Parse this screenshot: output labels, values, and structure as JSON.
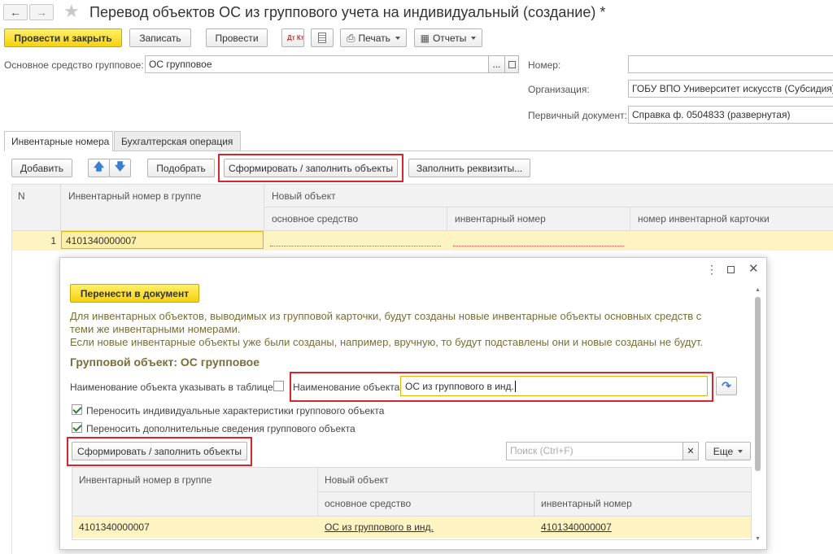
{
  "window": {
    "title": "Перевод объектов ОС из группового учета на индивидуальный (создание) *"
  },
  "toolbar": {
    "post_close": "Провести и закрыть",
    "save": "Записать",
    "post": "Провести",
    "dtkt": "Дт Кт",
    "print": "Печать",
    "reports": "Отчеты"
  },
  "header": {
    "os_group_label": "Основное средство групповое:",
    "os_group_value": "ОС групповое",
    "number_label": "Номер:",
    "number_value": "",
    "org_label": "Организация:",
    "org_value": "ГОБУ ВПО Университет искусств (Субсидия)",
    "primary_doc_label": "Первичный документ:",
    "primary_doc_value": "Справка ф. 0504833 (развернутая)"
  },
  "tabs": [
    {
      "label": "Инвентарные номера",
      "active": true
    },
    {
      "label": "Бухгалтерская операция",
      "active": false
    }
  ],
  "tab_toolbar": {
    "add": "Добавить",
    "pick": "Подобрать",
    "form_fill": "Сформировать / заполнить объекты",
    "fill_details": "Заполнить реквизиты..."
  },
  "main_table": {
    "col_n": "N",
    "col_inv_group": "Инвентарный номер в группе",
    "col_new_object": "Новый объект",
    "col_os": "основное средство",
    "col_inv_number": "инвентарный номер",
    "col_card_number": "номер инвентарной карточки",
    "rows": [
      {
        "n": "1",
        "inv_group": "4101340000007",
        "os": "",
        "inv_number": "",
        "card_number": ""
      }
    ]
  },
  "dialog": {
    "transfer_button": "Перенести в документ",
    "info_line1": "Для инвентарных объектов, выводимых из групповой карточки, будут созданы новые инвентарные объекты основных средств с",
    "info_line2": "теми же инвентарными номерами.",
    "info_line3": "Если новые инвентарные объекты уже были созданы, например, вручную, то будут подставлены они и новые созданы не будут.",
    "group_object_title": "Групповой объект: ОС групповое",
    "name_in_table_label": "Наименование объекта указывать в таблице:",
    "name_in_table_checked": false,
    "object_name_label": "Наименование объекта:",
    "object_name_value": "ОС из группового в инд.",
    "transfer_individual_label": "Переносить индивидуальные характеристики группового объекта",
    "transfer_individual_checked": true,
    "transfer_additional_label": "Переносить дополнительные сведения группового объекта",
    "transfer_additional_checked": true,
    "form_fill_button": "Сформировать / заполнить объекты",
    "search_placeholder": "Поиск (Ctrl+F)",
    "more_button": "Еще",
    "table": {
      "col_inv_group": "Инвентарный номер в группе",
      "col_new_object": "Новый объект",
      "col_os": "основное средство",
      "col_inv_number": "инвентарный номер",
      "rows": [
        {
          "inv_group": "4101340000007",
          "os": "ОС из группового в инд.",
          "inv_number": "4101340000007"
        }
      ]
    }
  },
  "colors": {
    "accent_yellow": "#f5d20e",
    "row_highlight": "#fdf3c3",
    "red_frame": "#d9232e",
    "label_olive": "#7a6d36",
    "icon_blue": "#3a7fcf"
  }
}
